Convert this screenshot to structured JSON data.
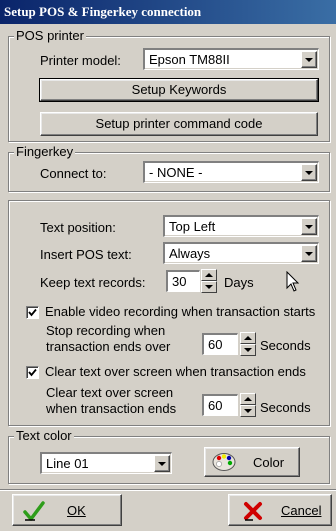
{
  "window": {
    "title": "Setup POS & Fingerkey connection"
  },
  "pos_printer": {
    "legend": "POS printer",
    "model_label": "Printer model:",
    "model_value": "Epson TM88II",
    "setup_keywords": "Setup Keywords",
    "setup_command": "Setup printer command code"
  },
  "fingerkey": {
    "legend": "Fingerkey",
    "connect_label": "Connect to:",
    "connect_value": "- NONE -"
  },
  "text": {
    "position_label": "Text position:",
    "position_value": "Top Left",
    "insert_label": "Insert POS text:",
    "insert_value": "Always",
    "keep_label": "Keep text records:",
    "keep_value": "30",
    "keep_unit": "Days"
  },
  "video": {
    "enable_label": "Enable video recording when transaction starts",
    "enable_checked": true,
    "stop_label_1": "Stop recording when",
    "stop_label_2": "transaction ends over",
    "stop_value": "60",
    "stop_unit": "Seconds"
  },
  "clear": {
    "clear_label": "Clear text over screen when transaction ends",
    "clear_checked": true,
    "after_label_1": "Clear text over screen",
    "after_label_2": "when transaction ends",
    "after_value": "60",
    "after_unit": "Seconds"
  },
  "text_color": {
    "legend": "Text color",
    "line_value": "Line 01",
    "color_button": "Color"
  },
  "footer": {
    "ok": "OK",
    "cancel": "Cancel"
  },
  "colors": {
    "ok_check": "#2e9d1a",
    "cancel_x": "#d00000",
    "title_bar": "#0a246a"
  }
}
